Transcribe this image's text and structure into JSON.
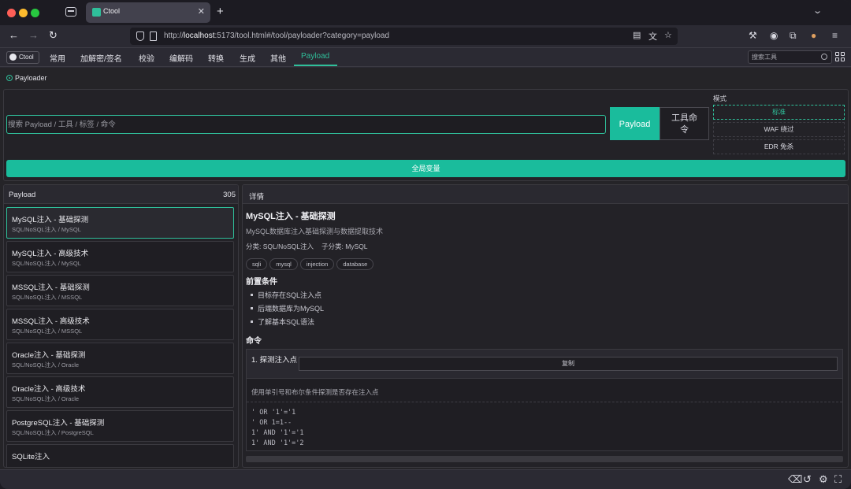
{
  "browser": {
    "tab_title": "Ctool",
    "url_prefix": "http://",
    "url_host": "localhost",
    "url_rest": ":5173/tool.html#/tool/payloader?category=payload"
  },
  "menu": {
    "brand": "Ctool",
    "items": [
      "常用",
      "加解密/签名",
      "校验",
      "编解码",
      "转换",
      "生成",
      "其他",
      "Payload"
    ],
    "active": "Payload",
    "search_placeholder": "搜索工具"
  },
  "tool": {
    "name": "Payloader",
    "search_placeholder": "搜索 Payload / 工具 / 标签 / 命令",
    "seg_payload": "Payload",
    "seg_tool": "工具命令",
    "mode_label": "模式",
    "modes": [
      "标准",
      "WAF 绕过",
      "EDR 免杀"
    ],
    "active_mode": "标准",
    "globals_button": "全局变量"
  },
  "list": {
    "title": "Payload",
    "count": "305",
    "items": [
      {
        "title": "MySQL注入 - 基础探测",
        "sub": "SQL/NoSQL注入 / MySQL"
      },
      {
        "title": "MySQL注入 - 高级技术",
        "sub": "SQL/NoSQL注入 / MySQL"
      },
      {
        "title": "MSSQL注入 - 基础探测",
        "sub": "SQL/NoSQL注入 / MSSQL"
      },
      {
        "title": "MSSQL注入 - 高级技术",
        "sub": "SQL/NoSQL注入 / MSSQL"
      },
      {
        "title": "Oracle注入 - 基础探测",
        "sub": "SQL/NoSQL注入 / Oracle"
      },
      {
        "title": "Oracle注入 - 高级技术",
        "sub": "SQL/NoSQL注入 / Oracle"
      },
      {
        "title": "PostgreSQL注入 - 基础探测",
        "sub": "SQL/NoSQL注入 / PostgreSQL"
      },
      {
        "title": "SQLite注入",
        "sub": ""
      }
    ]
  },
  "detail": {
    "header": "详情",
    "title": "MySQL注入 - 基础探测",
    "description": "MySQL数据库注入基础探测与数据提取技术",
    "category": "分类: SQL/NoSQL注入",
    "subcategory": "子分类: MySQL",
    "tags": [
      "sqli",
      "mysql",
      "injection",
      "database"
    ],
    "prereq_title": "前置条件",
    "prereqs": [
      "目标存在SQL注入点",
      "后端数据库为MySQL",
      "了解基本SQL语法"
    ],
    "commands_title": "命令",
    "command": {
      "name": "1. 探测注入点",
      "copy_label": "复制",
      "description": "使用单引号和布尔条件探测是否存在注入点",
      "code": "' OR '1'='1\n' OR 1=1--\n1' AND '1'='1\n1' AND '1'='2"
    }
  }
}
